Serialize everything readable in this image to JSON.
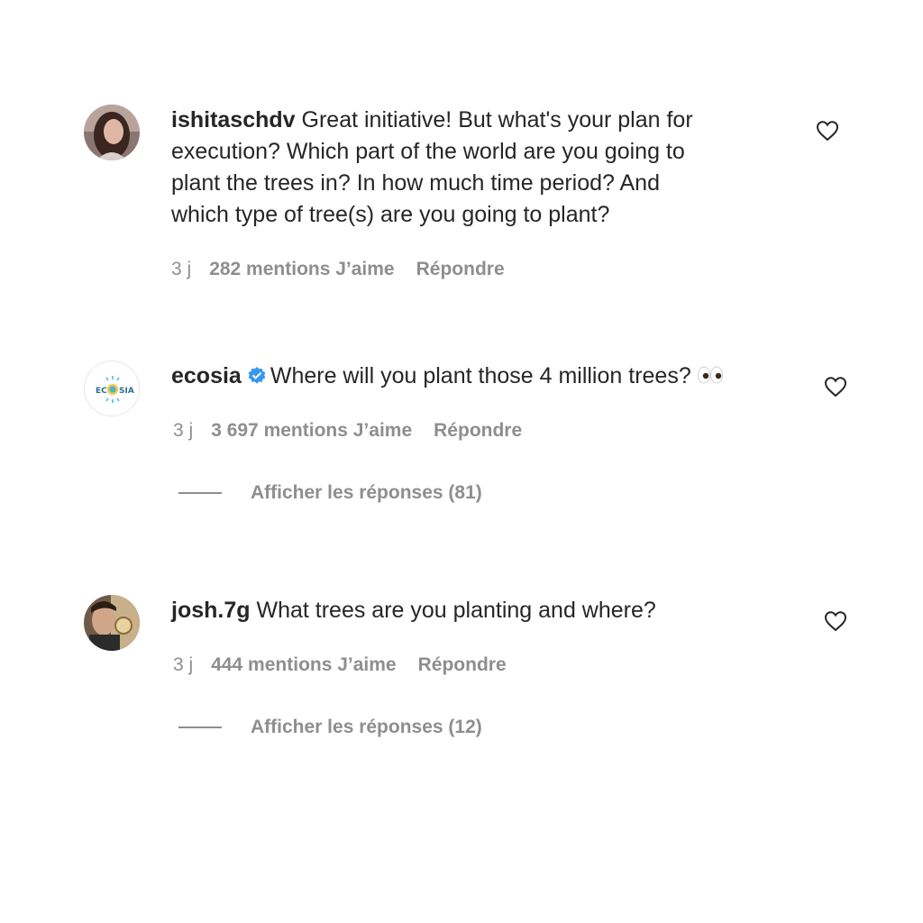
{
  "comments": [
    {
      "username": "ishitaschdv",
      "verified": false,
      "text_lines": [
        "Great initiative! But what's your plan for",
        "execution? Which part of the world are you going to",
        "plant the trees in? In how much time period? And",
        "which type of tree(s) are you going to plant?"
      ],
      "time": "3 j",
      "likes": "282 mentions J’aime",
      "reply": "Répondre"
    },
    {
      "username": "ecosia",
      "verified": true,
      "text": "Where will you plant those 4 million trees?",
      "emoji_icon": "eyes-emoji-icon",
      "time": "3 j",
      "likes": "3 697 mentions J’aime",
      "reply": "Répondre",
      "view_replies": "Afficher les réponses (81)"
    },
    {
      "username": "josh.7g",
      "verified": false,
      "text": "What trees are you planting and where?",
      "time": "3 j",
      "likes": "444 mentions J’aime",
      "reply": "Répondre",
      "view_replies": "Afficher les réponses (12)"
    }
  ],
  "ecosia_logo_text": "ECOSIA",
  "colors": {
    "text": "#262626",
    "secondary": "#8e8e8e",
    "verified_blue": "#3897f0"
  }
}
